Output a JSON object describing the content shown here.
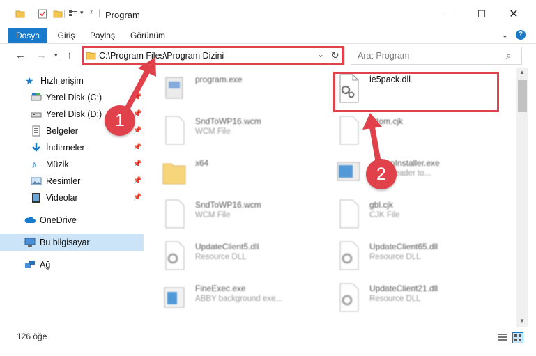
{
  "window": {
    "title": "Program",
    "minimize": "—",
    "maximize": "☐",
    "close": "✕"
  },
  "ribbon": {
    "tabs": [
      "Dosya",
      "Giriş",
      "Paylaş",
      "Görünüm"
    ],
    "collapse": "⌄",
    "help": "?"
  },
  "address": {
    "path": "C:\\Program Files\\Program Dizini",
    "search_placeholder": "Ara: Program"
  },
  "sidebar": {
    "items": [
      {
        "label": "Hızlı erişim",
        "icon": "star-icon",
        "pinned": false
      },
      {
        "label": "Yerel Disk (C:)",
        "icon": "drive-icon",
        "pinned": true
      },
      {
        "label": "Yerel Disk (D:)",
        "icon": "drive-icon",
        "pinned": true
      },
      {
        "label": "Belgeler",
        "icon": "documents-icon",
        "pinned": true
      },
      {
        "label": "İndirmeler",
        "icon": "download-icon",
        "pinned": true
      },
      {
        "label": "Müzik",
        "icon": "music-icon",
        "pinned": true
      },
      {
        "label": "Resimler",
        "icon": "pictures-icon",
        "pinned": true
      },
      {
        "label": "Videolar",
        "icon": "videos-icon",
        "pinned": true
      },
      {
        "label": "OneDrive",
        "icon": "cloud-icon",
        "pinned": false
      },
      {
        "label": "Bu bilgisayar",
        "icon": "computer-icon",
        "pinned": false,
        "selected": true
      },
      {
        "label": "Ağ",
        "icon": "network-icon",
        "pinned": false
      }
    ],
    "pin_glyph": "📌"
  },
  "files": {
    "left": [
      {
        "name": "program.exe",
        "type": ""
      },
      {
        "name": "SndToWP16.wcm",
        "type": "WCM File"
      },
      {
        "name": "x64",
        "type": ""
      },
      {
        "name": "SndToWP16.wcm",
        "type": "WCM File"
      },
      {
        "name": "UpdateClient5.dll",
        "type": "Resource DLL"
      },
      {
        "name": "FineExec.exe",
        "type": "ABBY background exe..."
      }
    ],
    "right": [
      {
        "name": "ie5pack.dll",
        "type": ""
      },
      {
        "name": "...tom.cjk",
        "type": ""
      },
      {
        "name": "...ammInstaller.exe",
        "type": "...fineReader to..."
      },
      {
        "name": "gbl.cjk",
        "type": "CJK File"
      },
      {
        "name": "UpdateClient65.dll",
        "type": "Resource DLL"
      },
      {
        "name": "UpdateClient21.dll",
        "type": "Resource DLL"
      }
    ]
  },
  "status": {
    "count": "126 öğe"
  },
  "annotations": {
    "badge1": "1",
    "badge2": "2",
    "color": "#e0414b"
  },
  "colors": {
    "accent": "#1979ca",
    "selected_bg": "#cce4f7"
  }
}
